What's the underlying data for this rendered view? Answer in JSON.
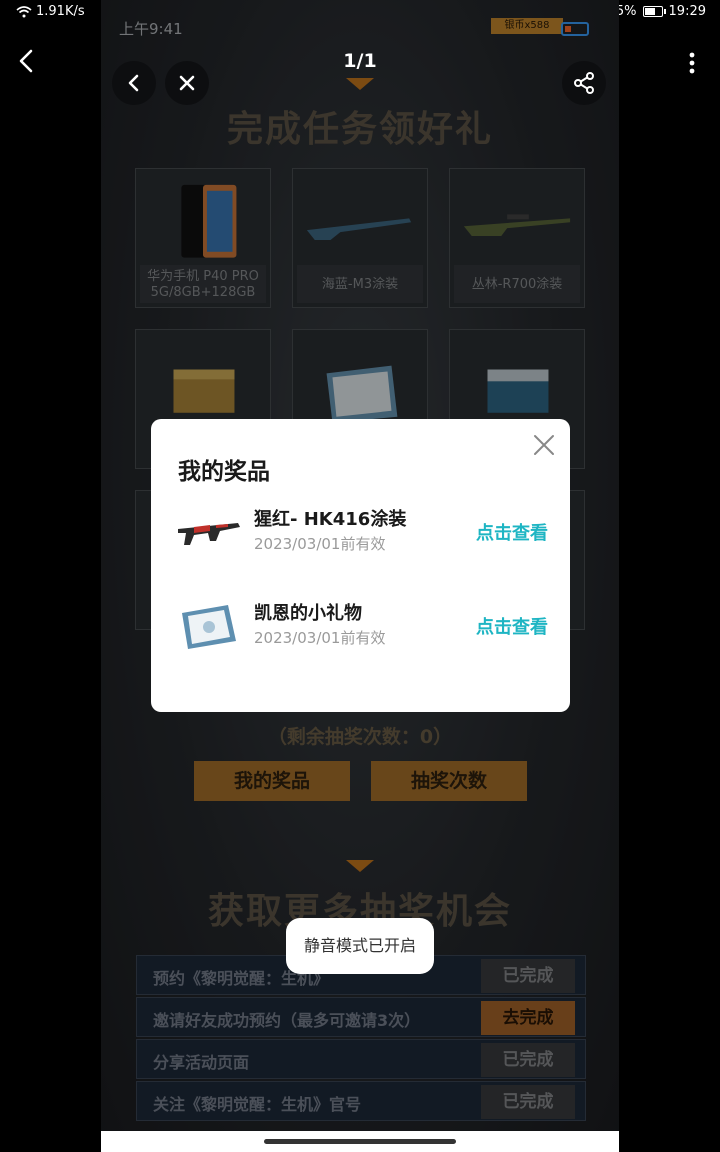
{
  "status_bar": {
    "network_speed": "1.91K/s",
    "battery_percent": "65%",
    "time": "19:29",
    "battery_level": 0.65
  },
  "viewer": {
    "page_indicator": "1/1"
  },
  "screenshot": {
    "inner_time": "上午9:41",
    "coin_tag": "银币x588",
    "banner_title": "完成任务领好礼",
    "prizes": [
      {
        "caption_line1": "华为手机 P40 PRO",
        "caption_line2": "5G/8GB+128GB"
      },
      {
        "caption_line1": "海蓝-M3涂装",
        "caption_line2": ""
      },
      {
        "caption_line1": "丛林-R700涂装",
        "caption_line2": ""
      }
    ],
    "remaining_draws": "（剩余抽奖次数：0）",
    "my_prizes_button": "我的奖品",
    "draw_count_button": "抽奖次数",
    "more_chances_title": "获取更多抽奖机会",
    "tasks": [
      {
        "label": "预约《黎明觉醒：生机》",
        "action": "已完成",
        "done": true
      },
      {
        "label": "邀请好友成功预约（最多可邀请3次）",
        "action": "去完成",
        "done": false
      },
      {
        "label": "分享活动页面",
        "action": "已完成",
        "done": true
      },
      {
        "label": "关注《黎明觉醒：生机》官号",
        "action": "已完成",
        "done": true
      }
    ]
  },
  "dialog": {
    "title": "我的奖品",
    "items": [
      {
        "name": "猩红- HK416涂装",
        "valid_until": "2023/03/01前有效",
        "action": "点击查看"
      },
      {
        "name": "凯恩的小礼物",
        "valid_until": "2023/03/01前有效",
        "action": "点击查看"
      }
    ]
  },
  "toast": "静音模式已开启",
  "colors": {
    "accent_teal": "#1eb5c3",
    "gold_button": "#a8722a",
    "dialog_bg": "#ffffff"
  }
}
